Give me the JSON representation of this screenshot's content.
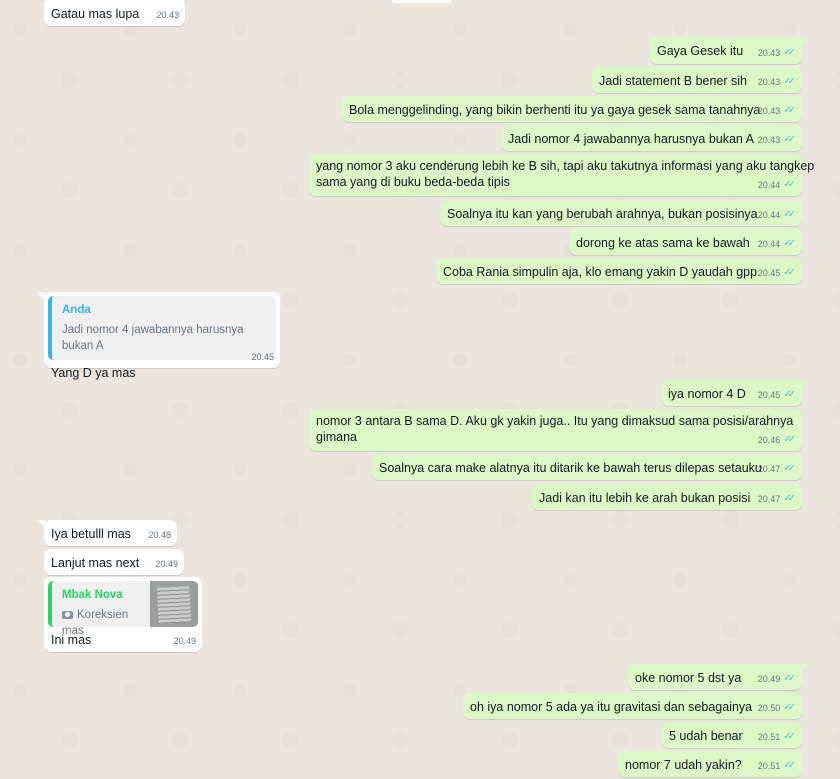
{
  "theme": {
    "outgoing_bg": "#dcf8c6",
    "incoming_bg": "#ffffff",
    "tick_color": "#53bdeb",
    "quote_anda_color": "#34b7f1",
    "quote_nova_color": "#25d366"
  },
  "messages": [
    {
      "text": "Gatau mas lupa",
      "time": "20.43"
    },
    {
      "text": "Gaya Gesek itu",
      "time": "20.43"
    },
    {
      "text": "Jadi statement B bener sih",
      "time": "20.43"
    },
    {
      "text": "Bola menggelinding, yang bikin berhenti itu ya gaya gesek sama tanahnya",
      "time": "20.43"
    },
    {
      "text": "Jadi nomor 4 jawabannya harusnya bukan A",
      "time": "20.43"
    },
    {
      "text": "yang nomor 3 aku cenderung lebih ke B sih, tapi aku takutnya informasi yang aku tangkep",
      "text2": "sama yang di buku beda-beda tipis",
      "time": "20.44"
    },
    {
      "text": "Soalnya itu kan yang berubah arahnya, bukan posisinya",
      "time": "20.44"
    },
    {
      "text": "dorong ke atas sama ke bawah",
      "time": "20.44"
    },
    {
      "text": "Coba Rania simpulin aja, klo emang yakin D yaudah gpp",
      "time": "20.45"
    },
    {
      "quote_author": "Anda",
      "quote_text": "Jadi nomor 4 jawabannya harusnya bukan A",
      "text": "Yang D ya mas",
      "time": "20.45"
    },
    {
      "text": "iya nomor 4 D",
      "time": "20.45"
    },
    {
      "text": "nomor 3 antara B sama D. Aku gk yakin juga.. Itu yang dimaksud sama posisi/arahnya",
      "text2": "gimana",
      "time": "20.46"
    },
    {
      "text": "Soalnya cara make alatnya itu ditarik ke bawah terus dilepas setauku",
      "time": "20.47"
    },
    {
      "text": "Jadi kan itu lebih ke arah bukan posisi",
      "time": "20.47"
    },
    {
      "text": "Iya betulll mas",
      "time": "20.48"
    },
    {
      "text": "Lanjut mas next",
      "time": "20.49"
    },
    {
      "quote_author": "Mbak Nova",
      "quote_text": "Koreksien mas",
      "text": "Ini mas",
      "time": "20.49"
    },
    {
      "text": "oke nomor 5 dst ya",
      "time": "20.49"
    },
    {
      "text": "oh iya nomor 5 ada ya itu gravitasi dan sebagainya",
      "time": "20.50"
    },
    {
      "text": "5 udah benar",
      "time": "20.51"
    },
    {
      "text": "nomor 7 udah yakin?",
      "time": "20.51"
    }
  ]
}
